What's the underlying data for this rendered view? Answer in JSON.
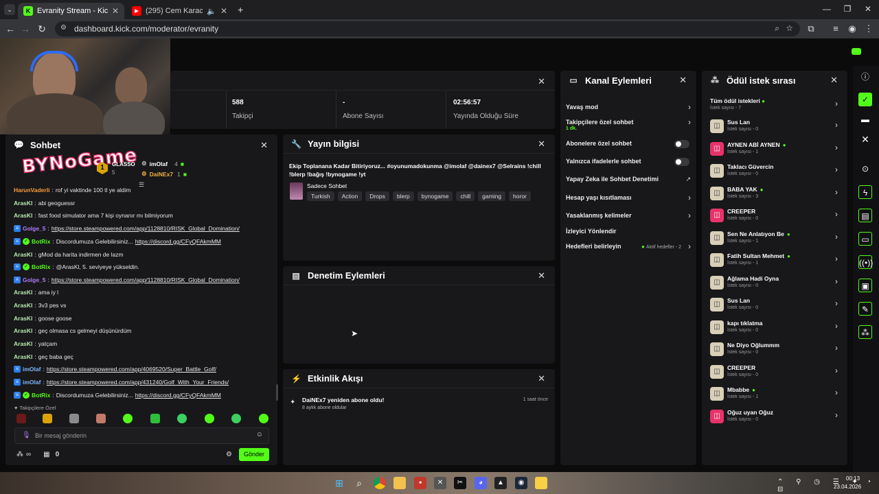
{
  "browser": {
    "tabs": [
      {
        "title": "Evranity Stream - Kick Dashboard",
        "favicon": "K"
      },
      {
        "title": "(295) Cem Karaca Beni Siz Del",
        "favicon": "▶"
      }
    ],
    "url": "dashboard.kick.com/moderator/evranity"
  },
  "stats": [
    {
      "value": "588",
      "label": "Takipçi"
    },
    {
      "value": "-",
      "label": "Abone Sayısı"
    },
    {
      "value": "02:56:57",
      "label": "Yayında Olduğu Süre"
    }
  ],
  "overlay": {
    "logo": "BYNoGame"
  },
  "chat": {
    "title": "Sohbet",
    "top_users": [
      {
        "name": "GLASSO",
        "count": ""
      },
      {
        "name": "imOlaf",
        "count": "4"
      },
      {
        "name": "DaiNEx7",
        "count": "1"
      }
    ],
    "top_rank": "1",
    "top_rank_count": "5",
    "messages": [
      {
        "user": "HarunVaderli",
        "text": "rof yi vaktinde 100 tl ye aldim",
        "color": "#ff9d3b",
        "link": ""
      },
      {
        "user": "ArasKl",
        "text": "abi geoguessr",
        "color": "#b8e8b0",
        "link": ""
      },
      {
        "user": "ArasKl",
        "text": "fast food simulator ama 7 kişi oynanır mı bilmiyorum",
        "color": "#b8e8b0",
        "link": ""
      },
      {
        "user": "Golge_5",
        "text": "",
        "color": "#b07dff",
        "link": "https://store.steampowered.com/app/1128810/RISK_Global_Domination/"
      },
      {
        "user": "BotRix",
        "text": "Discordumuza Gelebilirsiniz...",
        "color": "#53fc18",
        "link": "https://discord.gg/CFyQFAkmMM"
      },
      {
        "user": "ArasKl",
        "text": "gMod da harita indirmen de lazm",
        "color": "#b8e8b0",
        "link": ""
      },
      {
        "user": "BotRix",
        "text": "@ArasKl, 5. seviyeye yükseldin.",
        "color": "#53fc18",
        "link": ""
      },
      {
        "user": "Golge_5",
        "text": "",
        "color": "#b07dff",
        "link": "https://store.steampowered.com/app/1128810/RISK_Global_Domination/"
      },
      {
        "user": "ArasKl",
        "text": "ama iy l",
        "color": "#b8e8b0",
        "link": ""
      },
      {
        "user": "ArasKl",
        "text": "3v3 pes vs",
        "color": "#b8e8b0",
        "link": ""
      },
      {
        "user": "ArasKl",
        "text": "goose goose",
        "color": "#b8e8b0",
        "link": ""
      },
      {
        "user": "ArasKl",
        "text": "geç olmasa cs gelmeyi düşünürdüm",
        "color": "#b8e8b0",
        "link": ""
      },
      {
        "user": "ArasKl",
        "text": "yatçam",
        "color": "#b8e8b0",
        "link": ""
      },
      {
        "user": "ArasKl",
        "text": "geç baba geç",
        "color": "#b8e8b0",
        "link": ""
      },
      {
        "user": "imOlaf",
        "text": "",
        "color": "#7fb8ff",
        "link": "https://store.steampowered.com/app/4069520/Super_Battle_Golf/"
      },
      {
        "user": "imOlaf",
        "text": "",
        "color": "#7fb8ff",
        "link": "https://store.steampowered.com/app/431240/Golf_With_Your_Friends/"
      },
      {
        "user": "BotRix",
        "text": "Discordumuza Gelebilirsiniz...",
        "color": "#53fc18",
        "link": "https://discord.gg/CFyQFAkmMM"
      }
    ],
    "followers_only_label": "Takipçilere Özel",
    "input_placeholder": "Bir mesaj gönderin",
    "infinity": "∞",
    "count": "0",
    "send_label": "Gönder"
  },
  "stream_info": {
    "title": "Yayın bilgisi",
    "stream_title": "Ekip Toplanana Kadar Bitiriyoruz... #oyunumadokunma @imolaf @dainex7 @Selrains !chill !blerp !bağış !bynogame !yt",
    "category": "Sadece Sohbet",
    "tags": [
      "Turkish",
      "Action",
      "Drops",
      "blerp",
      "bynogame",
      "chill",
      "gaming",
      "horor"
    ]
  },
  "moderation": {
    "title": "Denetim Eylemleri"
  },
  "activity": {
    "title": "Etkinlik Akışı",
    "event_title": "DaiNEx7 yeniden abone oldu!",
    "event_sub": "8 aylık abone oldular",
    "event_time": "1 saat önce"
  },
  "channel_actions": {
    "title": "Kanal Eylemleri",
    "items": [
      {
        "label": "Yavaş mod",
        "sub": "",
        "type": "chevron"
      },
      {
        "label": "Takipçilere özel sohbet",
        "sub": "1 dk.",
        "type": "chevron"
      },
      {
        "label": "Abonelere özel sohbet",
        "sub": "",
        "type": "toggle"
      },
      {
        "label": "Yalnızca ifadelerle sohbet",
        "sub": "",
        "type": "toggle"
      },
      {
        "label": "Yapay Zeka ile Sohbet Denetimi",
        "sub": "",
        "type": "external"
      },
      {
        "label": "Hesap yaşı kısıtlaması",
        "sub": "",
        "type": "chevron"
      },
      {
        "label": "Yasaklanmış kelimeler",
        "sub": "",
        "type": "chevron"
      },
      {
        "label": "İzleyici Yönlendir",
        "sub": "",
        "type": "none"
      },
      {
        "label": "Hedefleri belirleyin",
        "sub": "",
        "type": "chevron",
        "extra": "Aktif hedefler - 2"
      }
    ]
  },
  "rewards": {
    "title": "Ödül istek sırası",
    "all_label": "Tüm ödül istekleri",
    "all_sub": "İstek sayısı - 7",
    "items": [
      {
        "name": "Sus Lan",
        "sub": "İstek sayısı - 0",
        "dot": false,
        "pink": false
      },
      {
        "name": "AYNEN ABİ AYNEN",
        "sub": "İstek sayısı - 1",
        "dot": true,
        "pink": true
      },
      {
        "name": "Taklacı Güvercin",
        "sub": "İstek sayısı - 0",
        "dot": false,
        "pink": false
      },
      {
        "name": "BABA YAK",
        "sub": "İstek sayısı - 3",
        "dot": true,
        "pink": false
      },
      {
        "name": "CREEPER",
        "sub": "İstek sayısı - 0",
        "dot": false,
        "pink": true
      },
      {
        "name": "Sen Ne Anlatıyon Be",
        "sub": "İstek sayısı - 1",
        "dot": true,
        "pink": false
      },
      {
        "name": "Fatih Sultan Mehmet",
        "sub": "İstek sayısı - 1",
        "dot": true,
        "pink": false
      },
      {
        "name": "Ağlama Hadi Oyna",
        "sub": "İstek sayısı - 0",
        "dot": false,
        "pink": false
      },
      {
        "name": "Sus Lan",
        "sub": "İstek sayısı - 0",
        "dot": false,
        "pink": false
      },
      {
        "name": "kapı tıklatma",
        "sub": "İstek sayısı - 0",
        "dot": false,
        "pink": false
      },
      {
        "name": "Ne Diyo Oğlummm",
        "sub": "İstek sayısı - 0",
        "dot": false,
        "pink": false
      },
      {
        "name": "CREEPER",
        "sub": "İstek sayısı - 0",
        "dot": false,
        "pink": false
      },
      {
        "name": "Mbabbe",
        "sub": "İstek sayısı - 1",
        "dot": true,
        "pink": false
      },
      {
        "name": "Oğuz uyan Oğuz",
        "sub": "İstek sayısı - 0",
        "dot": false,
        "pink": true
      }
    ]
  },
  "taskbar": {
    "time": "00:13",
    "date": "23.04.2026"
  },
  "colors": {
    "accent": "#53fc18",
    "panel": "#18181a",
    "bg": "#0b0b0c"
  }
}
